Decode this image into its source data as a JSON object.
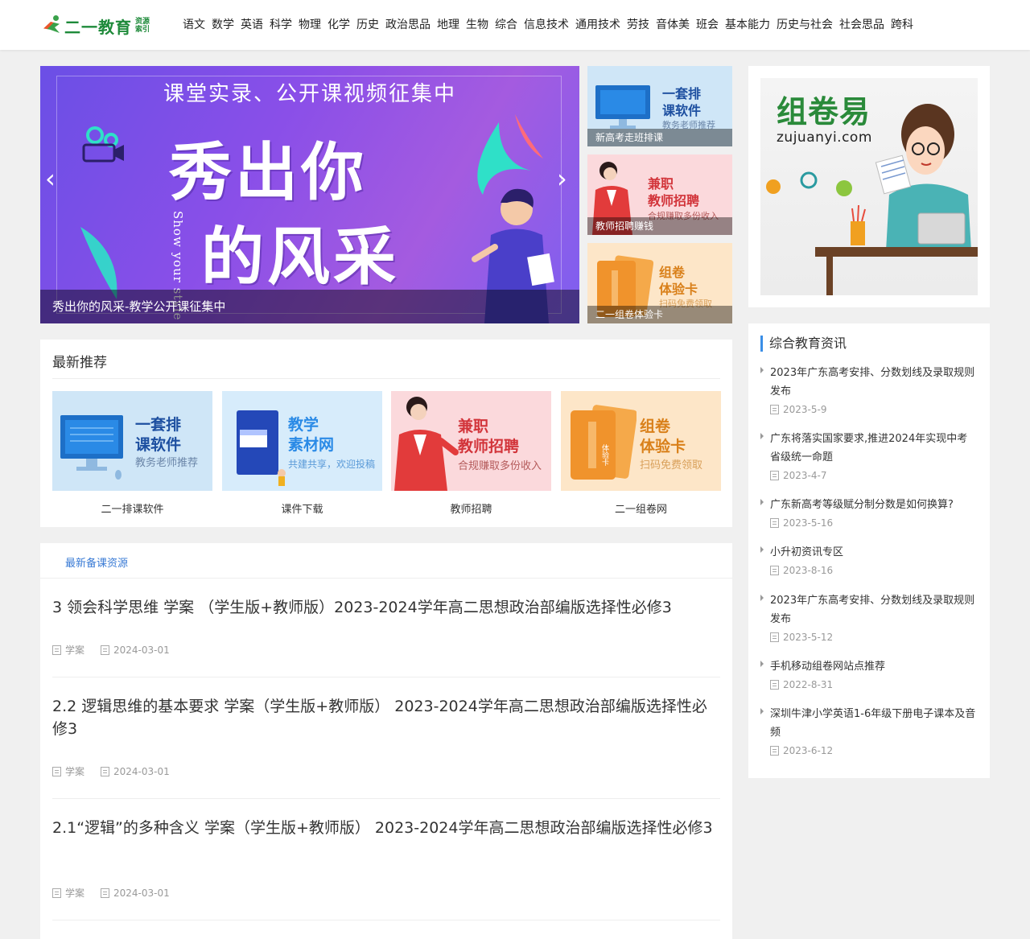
{
  "header": {
    "logo_text": "二一教育",
    "logo_sub1": "资源",
    "logo_sub2": "索引",
    "nav": [
      "语文",
      "数学",
      "英语",
      "科学",
      "物理",
      "化学",
      "历史",
      "政治思品",
      "地理",
      "生物",
      "综合",
      "信息技术",
      "通用技术",
      "劳技",
      "音体美",
      "班会",
      "基本能力",
      "历史与社会",
      "社会思品",
      "跨科"
    ]
  },
  "hero": {
    "top_text": "课堂实录、公开课视频征集中",
    "big_line1": "秀出你",
    "big_line2": "的风采",
    "vertical_text": "Show your style",
    "caption": "秀出你的风采-教学公开课征集中",
    "prev_icon": "chevron-left-icon",
    "next_icon": "chevron-right-icon"
  },
  "side_ads": [
    {
      "t1a": "一套排",
      "t1b": "课软件",
      "t2": "教务老师推荐",
      "caption": "新高考走班排课"
    },
    {
      "t1a": "兼职",
      "t1b": "教师招聘",
      "t2": "合规赚取多份收入",
      "caption": "教师招聘赚钱"
    },
    {
      "t1a": "组卷",
      "t1b": "体验卡",
      "t2": "扫码免费领取",
      "caption": "二一组卷体验卡"
    }
  ],
  "zujuan": {
    "cn": "组卷易",
    "en": "zujuanyi.com"
  },
  "recommend": {
    "title": "最新推荐",
    "items": [
      {
        "t1a": "一套排",
        "t1b": "课软件",
        "t2": "教务老师推荐",
        "label": "二一排课软件"
      },
      {
        "t1a": "教学",
        "t1b": "素材网",
        "t2": "共建共享，欢迎投稿",
        "label": "课件下载"
      },
      {
        "t1a": "兼职",
        "t1b": "教师招聘",
        "t2": "合规赚取多份收入",
        "label": "教师招聘"
      },
      {
        "t1a": "组卷",
        "t1b": "体验卡",
        "t2": "扫码免费领取",
        "label": "二一组卷网"
      }
    ],
    "card_tag": "体验卡"
  },
  "resources": {
    "tab": "最新备课资源",
    "items": [
      {
        "title": "3 领会科学思维 学案 （学生版+教师版）2023-2024学年高二思想政治部编版选择性必修3",
        "type": "学案",
        "date": "2024-03-01"
      },
      {
        "title": "2.2 逻辑思维的基本要求 学案（学生版+教师版） 2023-2024学年高二思想政治部编版选择性必修3",
        "type": "学案",
        "date": "2024-03-01"
      },
      {
        "title": "2.1“逻辑”的多种含义 学案（学生版+教师版） 2023-2024学年高二思想政治部编版选择性必修3",
        "type": "学案",
        "date": "2024-03-01"
      }
    ]
  },
  "news": {
    "title": "综合教育资讯",
    "items": [
      {
        "text": "2023年广东高考安排、分数划线及录取规则发布",
        "date": "2023-5-9"
      },
      {
        "text": "广东将落实国家要求,推进2024年实现中考省级统一命题",
        "date": "2023-4-7"
      },
      {
        "text": "广东新高考等级赋分制分数是如何换算?",
        "date": "2023-5-16"
      },
      {
        "text": "小升初资讯专区",
        "date": "2023-8-16"
      },
      {
        "text": "2023年广东高考安排、分数划线及录取规则发布",
        "date": "2023-5-12"
      },
      {
        "text": "手机移动组卷网站点推荐",
        "date": "2022-8-31"
      },
      {
        "text": "深圳牛津小学英语1-6年级下册电子课本及音频",
        "date": "2023-6-12"
      }
    ]
  },
  "colors": {
    "accent_blue": "#3a8ee6",
    "brand_green": "#1e8a3a",
    "tab_blue": "#3a7bd5"
  }
}
